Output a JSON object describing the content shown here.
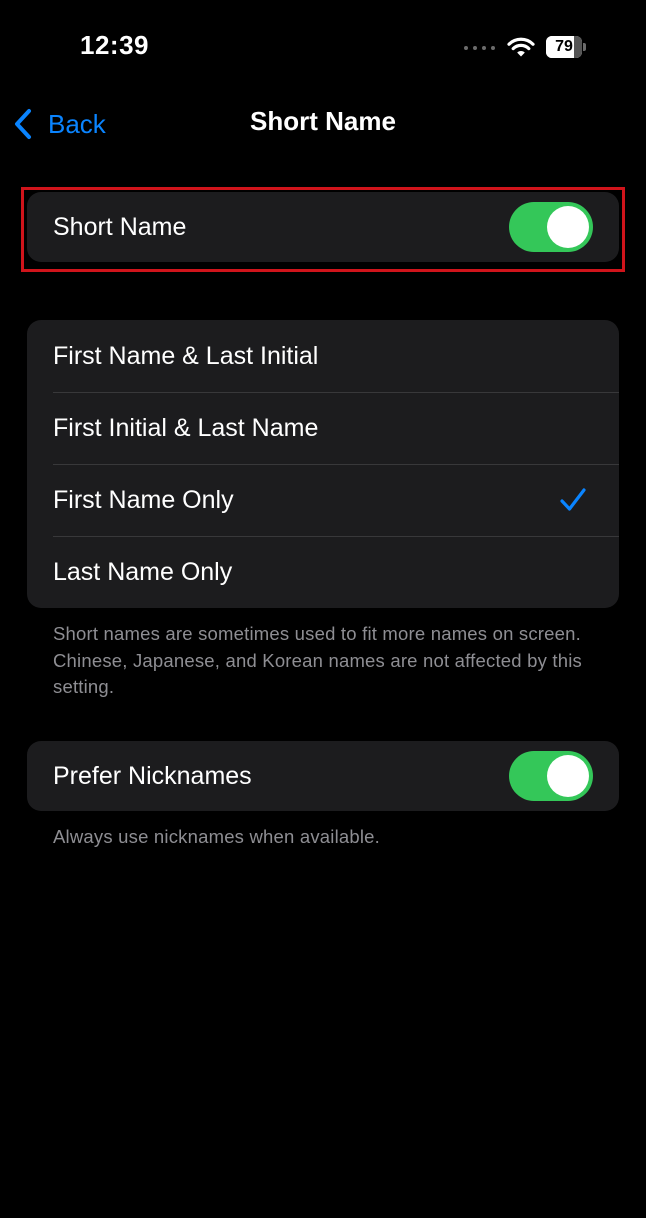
{
  "status_bar": {
    "time": "12:39",
    "battery_percent": "79",
    "battery_level": 0.79,
    "icons": [
      "signal-dots-icon",
      "wifi-icon",
      "battery-icon"
    ]
  },
  "nav": {
    "back_label": "Back",
    "title": "Short Name"
  },
  "short_name_toggle": {
    "label": "Short Name",
    "on": true
  },
  "format_options": {
    "items": [
      {
        "label": "First Name & Last Initial",
        "selected": false
      },
      {
        "label": "First Initial & Last Name",
        "selected": false
      },
      {
        "label": "First Name Only",
        "selected": true
      },
      {
        "label": "Last Name Only",
        "selected": false
      }
    ],
    "footnote": "Short names are sometimes used to fit more names on screen. Chinese, Japanese, and Korean names are not affected by this setting."
  },
  "nicknames": {
    "label": "Prefer Nicknames",
    "on": true,
    "footnote": "Always use nicknames when available."
  },
  "colors": {
    "accent": "#0a84ff",
    "toggle_on": "#34c759",
    "highlight": "#d0141b",
    "group_bg": "#1c1c1e",
    "background": "#000000"
  }
}
